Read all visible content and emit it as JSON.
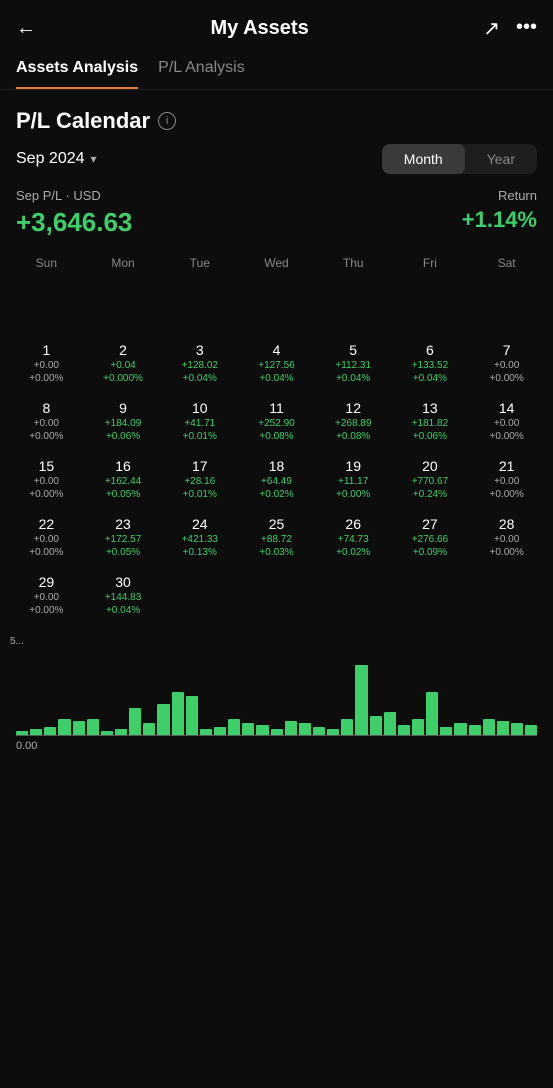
{
  "app": {
    "title": "My Assets"
  },
  "tabs": [
    {
      "id": "assets",
      "label": "Assets Analysis",
      "active": true
    },
    {
      "id": "pl",
      "label": "P/L Analysis",
      "active": false
    }
  ],
  "section": {
    "title": "P/L Calendar",
    "info_icon": "i"
  },
  "controls": {
    "period": "Sep 2024",
    "period_arrow": "▾",
    "view_options": [
      {
        "id": "month",
        "label": "Month",
        "active": true
      },
      {
        "id": "year",
        "label": "Year",
        "active": false
      }
    ]
  },
  "summary": {
    "pl_label": "Sep P/L · USD",
    "pl_value": "+3,646.63",
    "return_label": "Return",
    "return_value": "+1.14%"
  },
  "calendar": {
    "day_headers": [
      "Sun",
      "Mon",
      "Tue",
      "Wed",
      "Thu",
      "Fri",
      "Sat"
    ],
    "weeks": [
      [
        {
          "day": "",
          "pl": "",
          "pct": ""
        },
        {
          "day": "",
          "pl": "",
          "pct": ""
        },
        {
          "day": "",
          "pl": "",
          "pct": ""
        },
        {
          "day": "",
          "pl": "",
          "pct": ""
        },
        {
          "day": "",
          "pl": "",
          "pct": ""
        },
        {
          "day": "",
          "pl": "",
          "pct": ""
        },
        {
          "day": "",
          "pl": "",
          "pct": ""
        }
      ],
      [
        {
          "day": "1",
          "pl": "+0.00",
          "pct": "+0.00%"
        },
        {
          "day": "2",
          "pl": "+0.04",
          "pct": "+0.000%"
        },
        {
          "day": "3",
          "pl": "+128.02",
          "pct": "+0.04%"
        },
        {
          "day": "4",
          "pl": "+127.56",
          "pct": "+0.04%"
        },
        {
          "day": "5",
          "pl": "+112.31",
          "pct": "+0.04%"
        },
        {
          "day": "6",
          "pl": "+133.52",
          "pct": "+0.04%"
        },
        {
          "day": "7",
          "pl": "+0.00",
          "pct": "+0.00%"
        }
      ],
      [
        {
          "day": "8",
          "pl": "+0.00",
          "pct": "+0.00%"
        },
        {
          "day": "9",
          "pl": "+184.09",
          "pct": "+0.06%"
        },
        {
          "day": "10",
          "pl": "+41.71",
          "pct": "+0.01%"
        },
        {
          "day": "11",
          "pl": "+252.90",
          "pct": "+0.08%"
        },
        {
          "day": "12",
          "pl": "+268.89",
          "pct": "+0.08%"
        },
        {
          "day": "13",
          "pl": "+181.82",
          "pct": "+0.06%"
        },
        {
          "day": "14",
          "pl": "+0.00",
          "pct": "+0.00%"
        }
      ],
      [
        {
          "day": "15",
          "pl": "+0.00",
          "pct": "+0.00%"
        },
        {
          "day": "16",
          "pl": "+162.44",
          "pct": "+0.05%"
        },
        {
          "day": "17",
          "pl": "+28.16",
          "pct": "+0.01%"
        },
        {
          "day": "18",
          "pl": "+64.49",
          "pct": "+0.02%"
        },
        {
          "day": "19",
          "pl": "+11.17",
          "pct": "+0.00%"
        },
        {
          "day": "20",
          "pl": "+770.67",
          "pct": "+0.24%"
        },
        {
          "day": "21",
          "pl": "+0.00",
          "pct": "+0.00%"
        }
      ],
      [
        {
          "day": "22",
          "pl": "+0.00",
          "pct": "+0.00%"
        },
        {
          "day": "23",
          "pl": "+172.57",
          "pct": "+0.05%"
        },
        {
          "day": "24",
          "pl": "+421.33",
          "pct": "+0.13%"
        },
        {
          "day": "25",
          "pl": "+88.72",
          "pct": "+0.03%"
        },
        {
          "day": "26",
          "pl": "+74.73",
          "pct": "+0.02%"
        },
        {
          "day": "27",
          "pl": "+276.66",
          "pct": "+0.09%"
        },
        {
          "day": "28",
          "pl": "+0.00",
          "pct": "+0.00%"
        }
      ],
      [
        {
          "day": "29",
          "pl": "+0.00",
          "pct": "+0.00%"
        },
        {
          "day": "30",
          "pl": "+144.83",
          "pct": "+0.04%"
        },
        {
          "day": "",
          "pl": "",
          "pct": ""
        },
        {
          "day": "",
          "pl": "",
          "pct": ""
        },
        {
          "day": "",
          "pl": "",
          "pct": ""
        },
        {
          "day": "",
          "pl": "",
          "pct": ""
        },
        {
          "day": "",
          "pl": "",
          "pct": ""
        }
      ]
    ]
  },
  "chart": {
    "y_label": "5...",
    "baseline_label": "0.00",
    "bars": [
      2,
      3,
      4,
      8,
      7,
      8,
      2,
      3,
      14,
      6,
      16,
      22,
      20,
      3,
      4,
      8,
      6,
      5,
      3,
      7,
      6,
      4,
      3,
      8,
      36,
      10,
      12,
      5,
      8,
      22,
      4,
      6,
      5,
      8,
      7,
      6,
      5
    ]
  }
}
